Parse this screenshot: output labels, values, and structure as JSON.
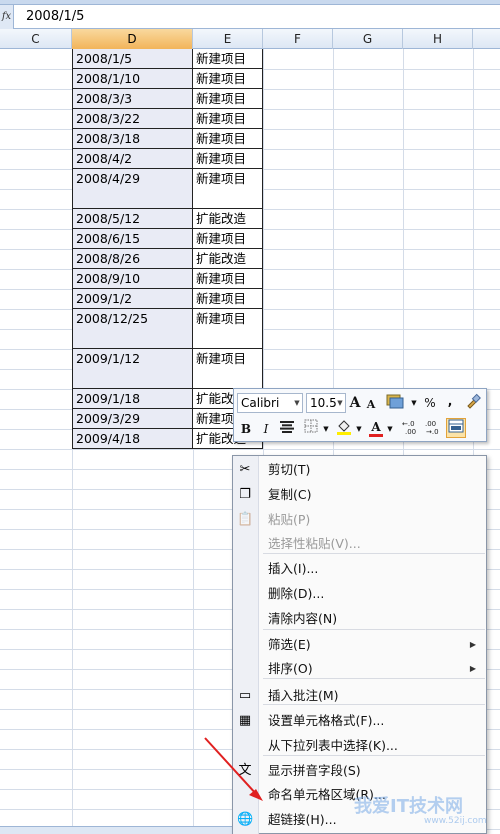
{
  "formula_bar": {
    "fx_label": "fx",
    "value": "2008/1/5"
  },
  "columns": [
    "C",
    "D",
    "E",
    "F",
    "G",
    "H"
  ],
  "rows": [
    {
      "date": "2008/1/5",
      "type": "新建项目"
    },
    {
      "date": "2008/1/10",
      "type": "新建项目"
    },
    {
      "date": "2008/3/3",
      "type": "新建项目"
    },
    {
      "date": "2008/3/22",
      "type": "新建项目"
    },
    {
      "date": "2008/3/18",
      "type": "新建项目"
    },
    {
      "date": "2008/4/2",
      "type": "新建项目"
    },
    {
      "date": "2008/4/29",
      "type": "新建项目"
    },
    {
      "date": "2008/5/12",
      "type": "扩能改造"
    },
    {
      "date": "2008/6/15",
      "type": "新建项目"
    },
    {
      "date": "2008/8/26",
      "type": "扩能改造"
    },
    {
      "date": "2008/9/10",
      "type": "新建项目"
    },
    {
      "date": "2009/1/2",
      "type": "新建项目"
    },
    {
      "date": "2008/12/25",
      "type": "新建项目"
    },
    {
      "date": "2009/1/12",
      "type": "新建项目"
    },
    {
      "date": "2009/1/18",
      "type": "扩能改"
    },
    {
      "date": "2009/3/29",
      "type": "新建项"
    },
    {
      "date": "2009/4/18",
      "type": "扩能改造"
    }
  ],
  "mini_toolbar": {
    "font": "Calibri",
    "size": "10.5",
    "grow_font": "A",
    "shrink_font": "A",
    "percent": "%",
    "comma": ",",
    "bold": "B",
    "italic": "I",
    "font_color_letter": "A",
    "inc_decimal": "←.0 .00",
    "dec_decimal": ".00 →.0"
  },
  "context_menu": [
    {
      "label": "剪切(T)",
      "icon": "scissors-icon",
      "disabled": false,
      "submenu": false
    },
    {
      "label": "复制(C)",
      "icon": "copy-icon",
      "disabled": false,
      "submenu": false
    },
    {
      "label": "粘贴(P)",
      "icon": "paste-icon",
      "disabled": true,
      "submenu": false
    },
    {
      "label": "选择性粘贴(V)...",
      "icon": "",
      "disabled": true,
      "submenu": false
    },
    {
      "label": "插入(I)...",
      "icon": "",
      "disabled": false,
      "submenu": false
    },
    {
      "label": "删除(D)...",
      "icon": "",
      "disabled": false,
      "submenu": false
    },
    {
      "label": "清除内容(N)",
      "icon": "",
      "disabled": false,
      "submenu": false
    },
    {
      "label": "筛选(E)",
      "icon": "",
      "disabled": false,
      "submenu": true
    },
    {
      "label": "排序(O)",
      "icon": "",
      "disabled": false,
      "submenu": true
    },
    {
      "label": "插入批注(M)",
      "icon": "comment-icon",
      "disabled": false,
      "submenu": false
    },
    {
      "label": "设置单元格格式(F)...",
      "icon": "format-cells-icon",
      "disabled": false,
      "submenu": false
    },
    {
      "label": "从下拉列表中选择(K)...",
      "icon": "",
      "disabled": false,
      "submenu": false
    },
    {
      "label": "显示拼音字段(S)",
      "icon": "phonetic-icon",
      "disabled": false,
      "submenu": false
    },
    {
      "label": "命名单元格区域(R)...",
      "icon": "",
      "disabled": false,
      "submenu": false
    },
    {
      "label": "超链接(H)...",
      "icon": "hyperlink-icon",
      "disabled": false,
      "submenu": false
    }
  ],
  "icons": {
    "scissors-icon": "✂",
    "copy-icon": "❐",
    "paste-icon": "📋",
    "comment-icon": "▭",
    "format-cells-icon": "▦",
    "phonetic-icon": "文",
    "hyperlink-icon": "🌐"
  },
  "colors": {
    "selection_fill": "#e9ebf5",
    "header_selected": "#f2b45a",
    "arrow": "#e02020"
  },
  "watermark": {
    "text": "我爱IT技术网",
    "sub": "www.52ij.com"
  }
}
